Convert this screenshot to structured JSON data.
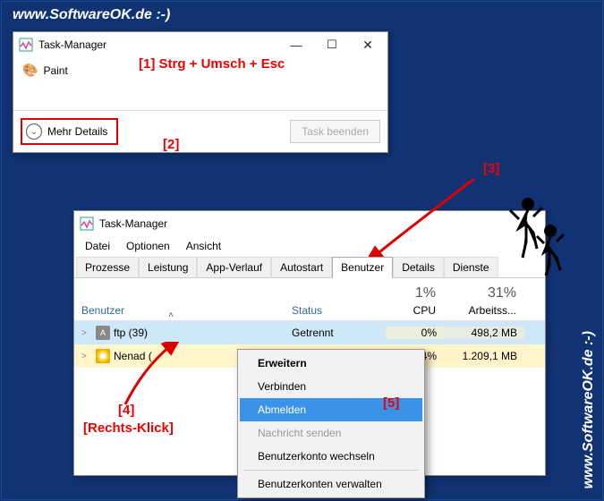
{
  "watermark": "www.SoftwareOK.de :-)",
  "small_window": {
    "title": "Task-Manager",
    "app_list": [
      "Paint"
    ],
    "more_details_label": "Mehr Details",
    "end_task_label": "Task beenden"
  },
  "large_window": {
    "title": "Task-Manager",
    "menu": [
      "Datei",
      "Optionen",
      "Ansicht"
    ],
    "tabs": [
      "Prozesse",
      "Leistung",
      "App-Verlauf",
      "Autostart",
      "Benutzer",
      "Details",
      "Dienste"
    ],
    "active_tab_index": 4,
    "columns": {
      "user": "Benutzer",
      "status": "Status",
      "cpu": {
        "value": "1%",
        "label": "CPU"
      },
      "mem": {
        "value": "31%",
        "label": "Arbeitss..."
      }
    },
    "rows": [
      {
        "expander": ">",
        "avatar": "A",
        "name": "ftp (39)",
        "status": "Getrennt",
        "cpu": "0%",
        "mem": "498,2 MB",
        "selected": true
      },
      {
        "expander": ">",
        "avatar": "sun",
        "name": "Nenad (",
        "status": "",
        "cpu": "1,4%",
        "mem": "1.209,1 MB",
        "selected": false
      }
    ]
  },
  "context_menu": {
    "items": [
      {
        "label": "Erweitern",
        "bold": true
      },
      {
        "label": "Verbinden"
      },
      {
        "label": "Abmelden",
        "highlighted": true
      },
      {
        "label": "Nachricht senden",
        "disabled": true
      },
      {
        "label": "Benutzerkonto wechseln"
      },
      {
        "sep": true
      },
      {
        "label": "Benutzerkonten verwalten"
      }
    ]
  },
  "annotations": {
    "a1": "[1]  Strg + Umsch + Esc",
    "a2": "[2]",
    "a3": "[3]",
    "a4": "[4]",
    "a4b": "[Rechts-Klick]",
    "a5": "[5]"
  }
}
